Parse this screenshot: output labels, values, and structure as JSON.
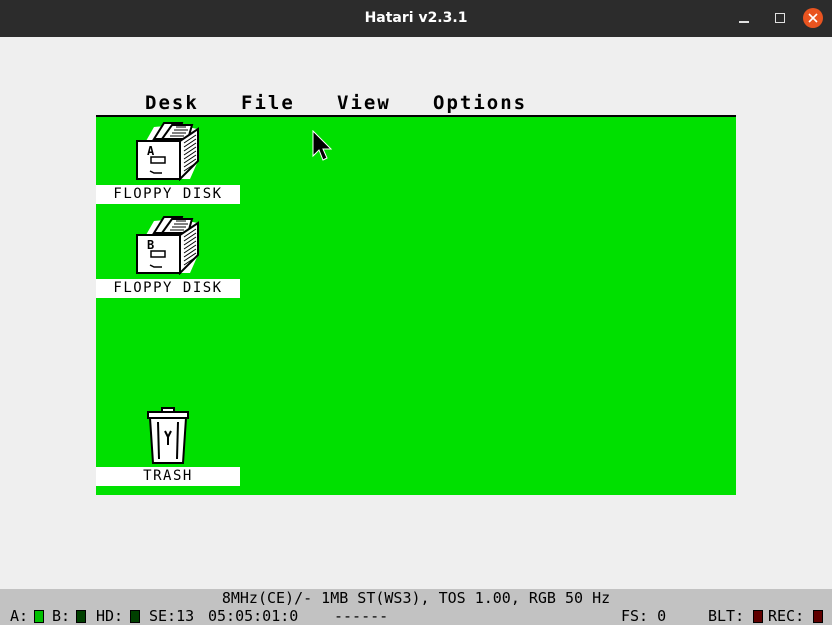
{
  "window": {
    "title": "Hatari v2.3.1"
  },
  "menu": {
    "items": [
      "Desk",
      "File",
      "View",
      "Options"
    ]
  },
  "desktop": {
    "background": "#00e000",
    "icons": [
      {
        "label": "FLOPPY DISK",
        "drive": "A"
      },
      {
        "label": "FLOPPY DISK",
        "drive": "B"
      },
      {
        "label": "TRASH"
      }
    ]
  },
  "statusbar": {
    "machine_info": "8MHz(CE)/- 1MB ST(WS3), TOS 1.00, RGB 50 Hz",
    "a_label": "A:",
    "b_label": "B:",
    "hd_label": "HD:",
    "se": "SE:13",
    "time": "05:05:01:0",
    "dashes": "------",
    "fs": "FS: 0",
    "blt_label": "BLT:",
    "rec_label": "REC:",
    "led_colors": {
      "a": "#00c000",
      "b": "#004000",
      "hd": "#004000",
      "blt": "#600000",
      "rec": "#600000"
    }
  }
}
